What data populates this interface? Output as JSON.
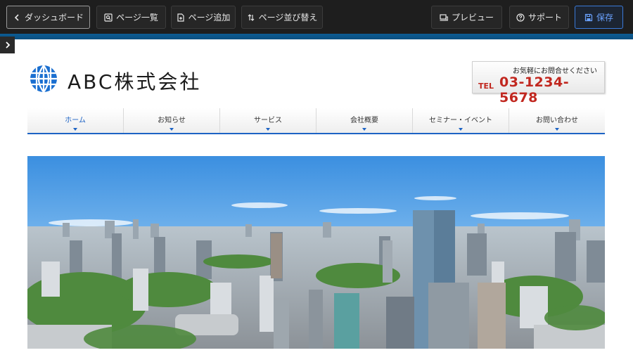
{
  "toolbar": {
    "dashboard_label": "ダッシュボード",
    "page_list_label": "ページ一覧",
    "add_page_label": "ページ追加",
    "reorder_label": "ページ並び替え",
    "preview_label": "プレビュー",
    "support_label": "サポート",
    "save_label": "保存"
  },
  "site": {
    "company_name": "ABC株式会社",
    "contact_message": "お気軽にお問合せください",
    "tel_label": "TEL",
    "tel_number": "03-1234-5678",
    "nav": [
      {
        "label": "ホーム",
        "active": true
      },
      {
        "label": "お知らせ"
      },
      {
        "label": "サービス"
      },
      {
        "label": "会社概要"
      },
      {
        "label": "セミナー・イベント"
      },
      {
        "label": "お問い合わせ"
      }
    ]
  },
  "colors": {
    "accent": "#1d63c4",
    "tel": "#c1271f",
    "toolbar_bg": "#1e1e1e",
    "save": "#3b7ad8"
  },
  "icons": {
    "dashboard": "chevron-left-icon",
    "page_list": "search-page-icon",
    "add_page": "add-page-icon",
    "reorder": "sort-arrows-icon",
    "preview": "devices-icon",
    "support": "question-circle-icon",
    "save": "floppy-disk-icon",
    "side_toggle": "chevron-right-icon",
    "logo": "globe-logo-icon"
  }
}
